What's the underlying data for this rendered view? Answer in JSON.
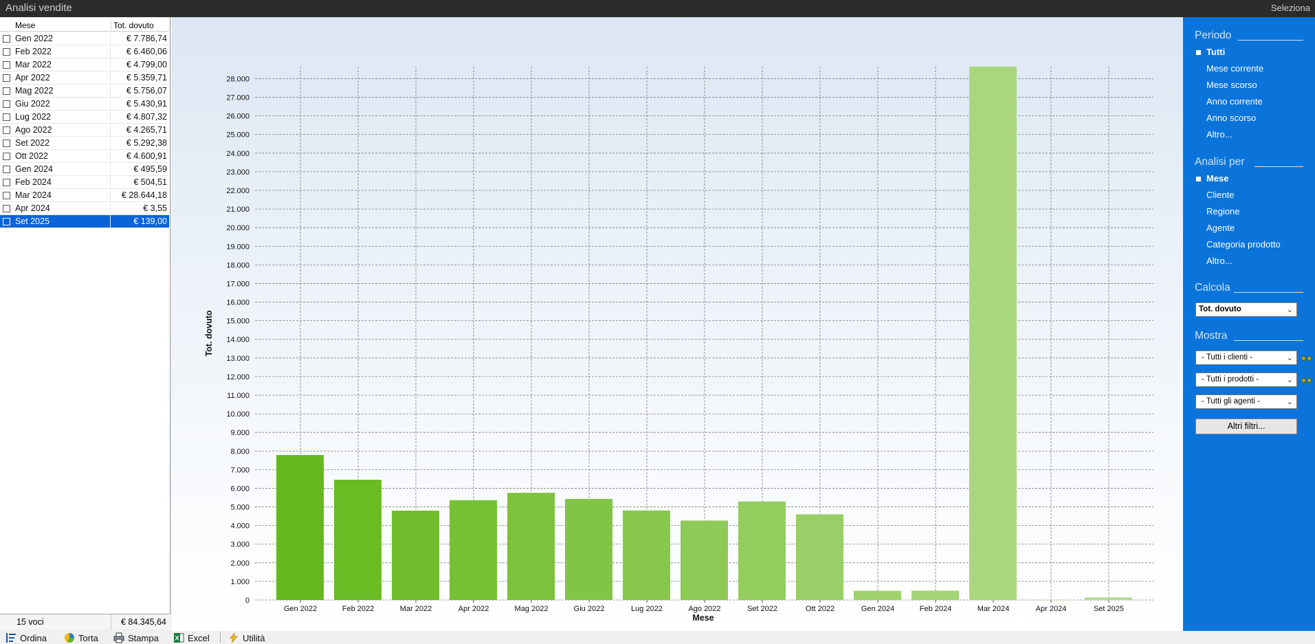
{
  "window": {
    "title": "Analisi vendite",
    "select_label": "Seleziona"
  },
  "table": {
    "headers": {
      "month": "Mese",
      "total": "Tot. dovuto"
    },
    "rows": [
      {
        "month": "Gen 2022",
        "total": "€ 7.786,74"
      },
      {
        "month": "Feb 2022",
        "total": "€ 6.460,06"
      },
      {
        "month": "Mar 2022",
        "total": "€ 4.799,00"
      },
      {
        "month": "Apr 2022",
        "total": "€ 5.359,71"
      },
      {
        "month": "Mag 2022",
        "total": "€ 5.756,07"
      },
      {
        "month": "Giu 2022",
        "total": "€ 5.430,91"
      },
      {
        "month": "Lug 2022",
        "total": "€ 4.807,32"
      },
      {
        "month": "Ago 2022",
        "total": "€ 4.265,71"
      },
      {
        "month": "Set 2022",
        "total": "€ 5.292,38"
      },
      {
        "month": "Ott 2022",
        "total": "€ 4.600,91"
      },
      {
        "month": "Gen 2024",
        "total": "€ 495,59"
      },
      {
        "month": "Feb 2024",
        "total": "€ 504,51"
      },
      {
        "month": "Mar 2024",
        "total": "€ 28.644,18"
      },
      {
        "month": "Apr 2024",
        "total": "€ 3,55"
      },
      {
        "month": "Set 2025",
        "total": "€ 139,00"
      }
    ],
    "selected_index": 14,
    "footer": {
      "count": "15 voci",
      "total": "€ 84.345,64"
    }
  },
  "toolbar": {
    "sort": "Ordina",
    "pie": "Torta",
    "print": "Stampa",
    "excel": "Excel",
    "utility": "Utilità"
  },
  "sidebar": {
    "period": {
      "title": "Periodo",
      "options": [
        "Tutti",
        "Mese corrente",
        "Mese scorso",
        "Anno corrente",
        "Anno scorso",
        "Altro..."
      ],
      "selected": "Tutti"
    },
    "analysis": {
      "title": "Analisi per",
      "options": [
        "Mese",
        "Cliente",
        "Regione",
        "Agente",
        "Categoria prodotto",
        "Altro..."
      ],
      "selected": "Mese"
    },
    "calc": {
      "title": "Calcola",
      "value": "Tot. dovuto"
    },
    "show": {
      "title": "Mostra",
      "clients": "- Tutti i clienti -",
      "products": "- Tutti i prodotti -",
      "agents": "- Tutti gli agenti -",
      "more_filters": "Altri filtri..."
    }
  },
  "chart_data": {
    "type": "bar",
    "xlabel": "Mese",
    "ylabel": "Tot. dovuto",
    "categories": [
      "Gen 2022",
      "Feb 2022",
      "Mar 2022",
      "Apr 2022",
      "Mag 2022",
      "Giu 2022",
      "Lug 2022",
      "Ago 2022",
      "Set 2022",
      "Ott 2022",
      "Gen 2024",
      "Feb 2024",
      "Mar 2024",
      "Apr 2024",
      "Set 2025"
    ],
    "values": [
      7786.74,
      6460.06,
      4799.0,
      5359.71,
      5756.07,
      5430.91,
      4807.32,
      4265.71,
      5292.38,
      4600.91,
      495.59,
      504.51,
      28644.18,
      3.55,
      139.0
    ],
    "ylim": [
      0,
      28644.18
    ],
    "yticks": [
      0,
      1000,
      2000,
      3000,
      4000,
      5000,
      6000,
      7000,
      8000,
      9000,
      10000,
      11000,
      12000,
      13000,
      14000,
      15000,
      16000,
      17000,
      18000,
      19000,
      20000,
      21000,
      22000,
      23000,
      24000,
      25000,
      26000,
      27000,
      28000
    ],
    "ytick_labels": [
      "0",
      "1.000",
      "2.000",
      "3.000",
      "4.000",
      "5.000",
      "6.000",
      "7.000",
      "8.000",
      "9.000",
      "10.000",
      "11.000",
      "12.000",
      "13.000",
      "14.000",
      "15.000",
      "16.000",
      "17.000",
      "18.000",
      "19.000",
      "20.000",
      "21.000",
      "22.000",
      "23.000",
      "24.000",
      "25.000",
      "26.000",
      "27.000",
      "28.000"
    ],
    "grid": true,
    "legend": "none",
    "color_start": "#65b81d",
    "color_end": "#b6dc8e"
  }
}
